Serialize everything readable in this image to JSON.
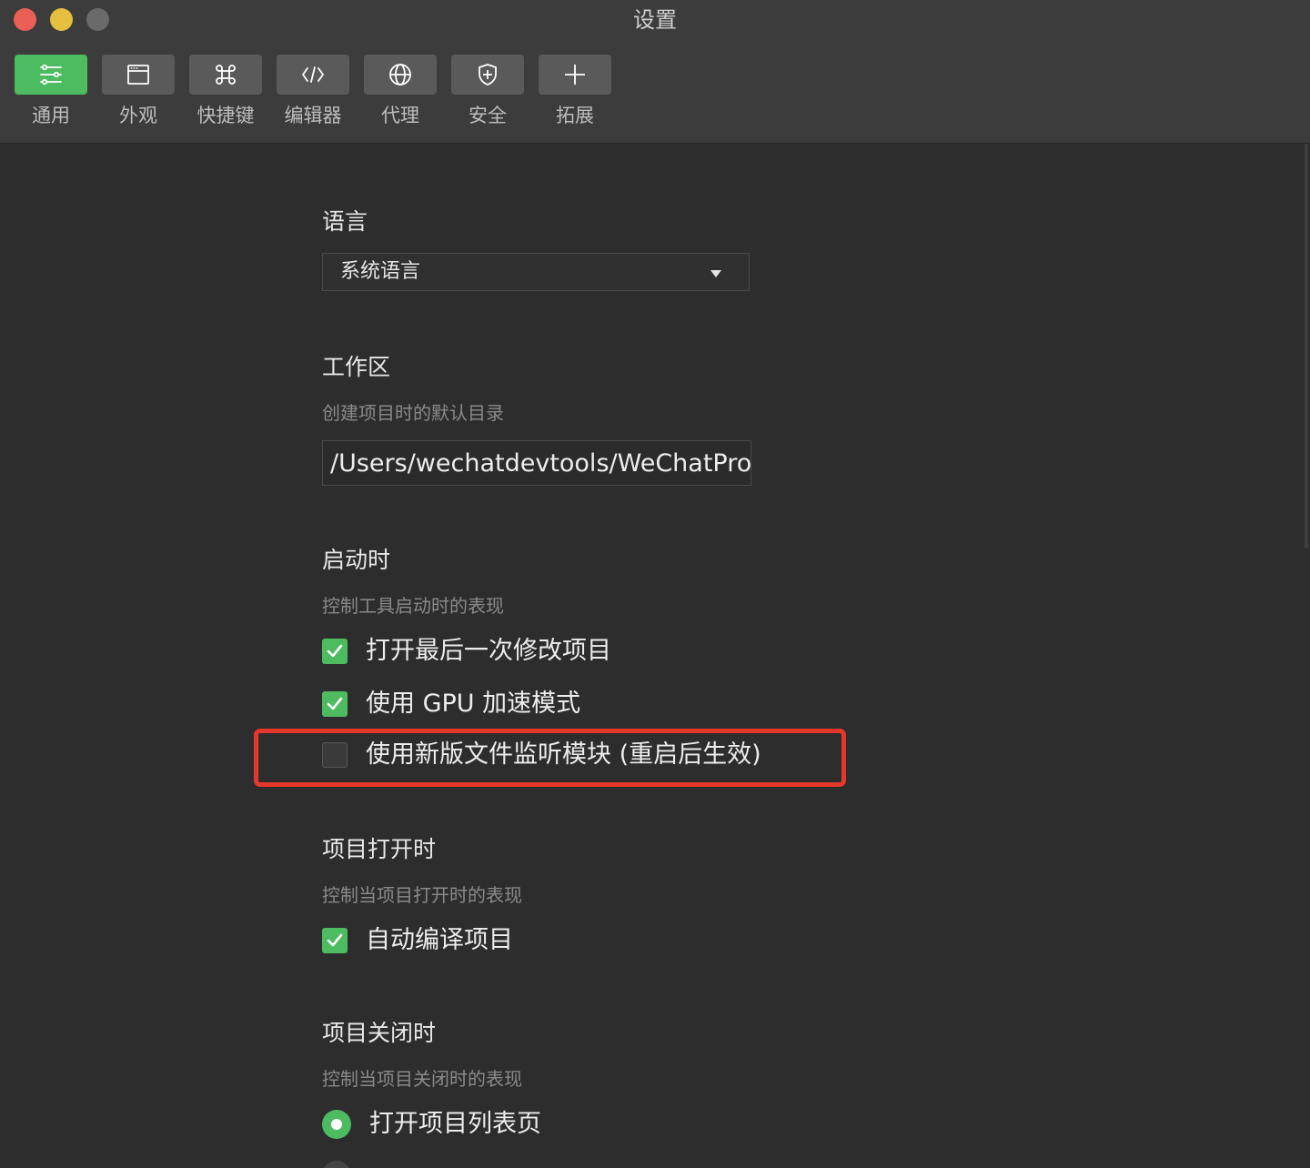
{
  "window": {
    "title": "设置"
  },
  "toolbar": {
    "items": [
      {
        "label": "通用",
        "icon": "sliders-icon",
        "active": true
      },
      {
        "label": "外观",
        "icon": "window-icon",
        "active": false
      },
      {
        "label": "快捷键",
        "icon": "command-key-icon",
        "active": false
      },
      {
        "label": "编辑器",
        "icon": "code-icon",
        "active": false
      },
      {
        "label": "代理",
        "icon": "globe-icon",
        "active": false
      },
      {
        "label": "安全",
        "icon": "shield-icon",
        "active": false
      },
      {
        "label": "拓展",
        "icon": "plus-icon",
        "active": false
      }
    ]
  },
  "language": {
    "title": "语言",
    "selected": "系统语言"
  },
  "workspace": {
    "title": "工作区",
    "desc": "创建项目时的默认目录",
    "path": "/Users/wechatdevtools/WeChatProjects"
  },
  "startup": {
    "title": "启动时",
    "desc": "控制工具启动时的表现",
    "options": [
      {
        "label": "打开最后一次修改项目",
        "checked": true
      },
      {
        "label": "使用 GPU 加速模式",
        "checked": true
      },
      {
        "label": "使用新版文件监听模块 (重启后生效)",
        "checked": false
      }
    ]
  },
  "project_open": {
    "title": "项目打开时",
    "desc": "控制当项目打开时的表现",
    "options": [
      {
        "label": "自动编译项目",
        "checked": true
      }
    ]
  },
  "project_close": {
    "title": "项目关闭时",
    "desc": "控制当项目关闭时的表现",
    "options": [
      {
        "label": "打开项目列表页",
        "selected": true
      }
    ]
  },
  "colors": {
    "accent": "#4dbb5f",
    "highlight_border": "#e5382a",
    "background": "#2d2d2d"
  }
}
